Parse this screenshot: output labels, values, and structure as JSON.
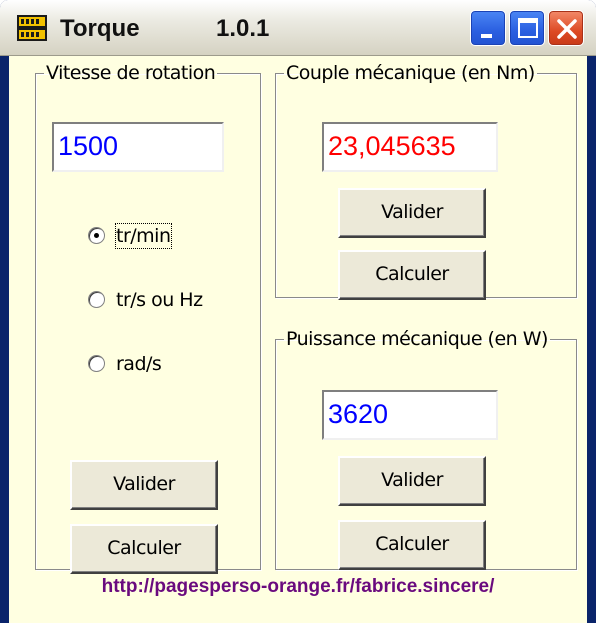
{
  "window": {
    "title": "Torque",
    "version": "1.0.1",
    "icon": "app-icon"
  },
  "speed_group": {
    "legend": "Vitesse de rotation",
    "value": "1500",
    "value_color": "#0000ff",
    "units": [
      {
        "label": "tr/min",
        "selected": true
      },
      {
        "label": "tr/s ou Hz",
        "selected": false
      },
      {
        "label": "rad/s",
        "selected": false
      }
    ],
    "validate_label": "Valider",
    "compute_label": "Calculer"
  },
  "torque_group": {
    "legend": "Couple mécanique (en Nm)",
    "value": "23,045635",
    "value_color": "#ff0000",
    "validate_label": "Valider",
    "compute_label": "Calculer"
  },
  "power_group": {
    "legend": "Puissance mécanique (en W)",
    "value": "3620",
    "value_color": "#0000ff",
    "validate_label": "Valider",
    "compute_label": "Calculer"
  },
  "footer": {
    "url": "http://pagesperso-orange.fr/fabrice.sincere/"
  },
  "colors": {
    "client_bg": "#ffffe1",
    "titlebar_button": "#2a5fe0",
    "close_button": "#dd4a24",
    "url_color": "#6a0a7e"
  }
}
